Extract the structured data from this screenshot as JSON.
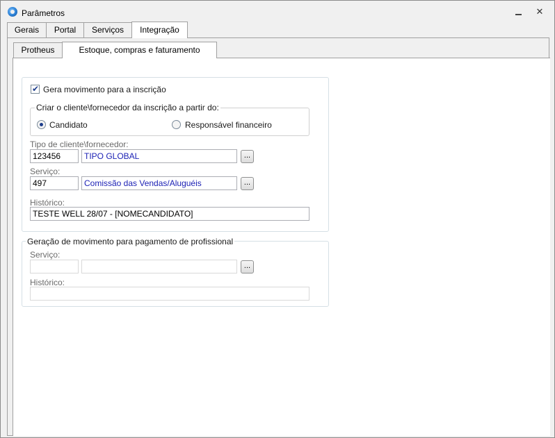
{
  "window": {
    "title": "Parâmetros",
    "minimize_label": "",
    "close_label": "✕"
  },
  "top_tabs": [
    {
      "label": "Gerais"
    },
    {
      "label": "Portal"
    },
    {
      "label": "Serviços"
    },
    {
      "label": "Integração",
      "active": true
    }
  ],
  "inner_tabs": [
    {
      "label": "Protheus"
    },
    {
      "label": "Estoque, compras e faturamento",
      "active": true
    }
  ],
  "section1": {
    "gera_movimento": {
      "label": "Gera movimento para a inscrição",
      "checked": true
    },
    "criar_cliente": {
      "legend": "Criar o cliente\\fornecedor da inscrição a partir do:",
      "options": [
        {
          "label": "Candidato",
          "selected": true
        },
        {
          "label": "Responsável financeiro",
          "selected": false
        }
      ]
    },
    "tipo_cliente": {
      "label": "Tipo de cliente\\fornecedor:",
      "code": "123456",
      "description": "TIPO GLOBAL",
      "button": "..."
    },
    "servico": {
      "label": "Serviço:",
      "code": "497",
      "description": "Comissão das Vendas/Aluguéis",
      "button": "..."
    },
    "historico": {
      "label": "Histórico:",
      "value": "TESTE WELL 28/07 - [NOMECANDIDATO]"
    }
  },
  "section2": {
    "legend": "Geração de movimento para pagamento de profissional",
    "servico": {
      "label": "Serviço:",
      "code": "",
      "description": "",
      "button": "..."
    },
    "historico": {
      "label": "Histórico:",
      "value": ""
    }
  }
}
